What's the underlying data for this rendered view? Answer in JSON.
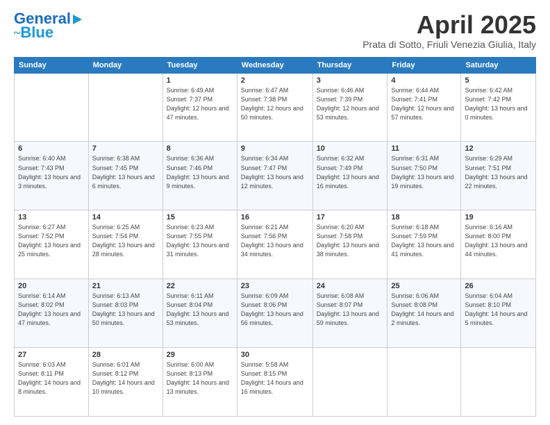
{
  "logo": {
    "line1": "General",
    "line2": "Blue"
  },
  "title": {
    "month": "April 2025",
    "location": "Prata di Sotto, Friuli Venezia Giulia, Italy"
  },
  "headers": [
    "Sunday",
    "Monday",
    "Tuesday",
    "Wednesday",
    "Thursday",
    "Friday",
    "Saturday"
  ],
  "weeks": [
    [
      {
        "day": "",
        "info": ""
      },
      {
        "day": "",
        "info": ""
      },
      {
        "day": "1",
        "info": "Sunrise: 6:49 AM\nSunset: 7:37 PM\nDaylight: 12 hours\nand 47 minutes."
      },
      {
        "day": "2",
        "info": "Sunrise: 6:47 AM\nSunset: 7:38 PM\nDaylight: 12 hours\nand 50 minutes."
      },
      {
        "day": "3",
        "info": "Sunrise: 6:46 AM\nSunset: 7:39 PM\nDaylight: 12 hours\nand 53 minutes."
      },
      {
        "day": "4",
        "info": "Sunrise: 6:44 AM\nSunset: 7:41 PM\nDaylight: 12 hours\nand 57 minutes."
      },
      {
        "day": "5",
        "info": "Sunrise: 6:42 AM\nSunset: 7:42 PM\nDaylight: 13 hours\nand 0 minutes."
      }
    ],
    [
      {
        "day": "6",
        "info": "Sunrise: 6:40 AM\nSunset: 7:43 PM\nDaylight: 13 hours\nand 3 minutes."
      },
      {
        "day": "7",
        "info": "Sunrise: 6:38 AM\nSunset: 7:45 PM\nDaylight: 13 hours\nand 6 minutes."
      },
      {
        "day": "8",
        "info": "Sunrise: 6:36 AM\nSunset: 7:46 PM\nDaylight: 13 hours\nand 9 minutes."
      },
      {
        "day": "9",
        "info": "Sunrise: 6:34 AM\nSunset: 7:47 PM\nDaylight: 13 hours\nand 12 minutes."
      },
      {
        "day": "10",
        "info": "Sunrise: 6:32 AM\nSunset: 7:49 PM\nDaylight: 13 hours\nand 16 minutes."
      },
      {
        "day": "11",
        "info": "Sunrise: 6:31 AM\nSunset: 7:50 PM\nDaylight: 13 hours\nand 19 minutes."
      },
      {
        "day": "12",
        "info": "Sunrise: 6:29 AM\nSunset: 7:51 PM\nDaylight: 13 hours\nand 22 minutes."
      }
    ],
    [
      {
        "day": "13",
        "info": "Sunrise: 6:27 AM\nSunset: 7:52 PM\nDaylight: 13 hours\nand 25 minutes."
      },
      {
        "day": "14",
        "info": "Sunrise: 6:25 AM\nSunset: 7:54 PM\nDaylight: 13 hours\nand 28 minutes."
      },
      {
        "day": "15",
        "info": "Sunrise: 6:23 AM\nSunset: 7:55 PM\nDaylight: 13 hours\nand 31 minutes."
      },
      {
        "day": "16",
        "info": "Sunrise: 6:21 AM\nSunset: 7:56 PM\nDaylight: 13 hours\nand 34 minutes."
      },
      {
        "day": "17",
        "info": "Sunrise: 6:20 AM\nSunset: 7:58 PM\nDaylight: 13 hours\nand 38 minutes."
      },
      {
        "day": "18",
        "info": "Sunrise: 6:18 AM\nSunset: 7:59 PM\nDaylight: 13 hours\nand 41 minutes."
      },
      {
        "day": "19",
        "info": "Sunrise: 6:16 AM\nSunset: 8:00 PM\nDaylight: 13 hours\nand 44 minutes."
      }
    ],
    [
      {
        "day": "20",
        "info": "Sunrise: 6:14 AM\nSunset: 8:02 PM\nDaylight: 13 hours\nand 47 minutes."
      },
      {
        "day": "21",
        "info": "Sunrise: 6:13 AM\nSunset: 8:03 PM\nDaylight: 13 hours\nand 50 minutes."
      },
      {
        "day": "22",
        "info": "Sunrise: 6:11 AM\nSunset: 8:04 PM\nDaylight: 13 hours\nand 53 minutes."
      },
      {
        "day": "23",
        "info": "Sunrise: 6:09 AM\nSunset: 8:06 PM\nDaylight: 13 hours\nand 56 minutes."
      },
      {
        "day": "24",
        "info": "Sunrise: 6:08 AM\nSunset: 8:07 PM\nDaylight: 13 hours\nand 59 minutes."
      },
      {
        "day": "25",
        "info": "Sunrise: 6:06 AM\nSunset: 8:08 PM\nDaylight: 14 hours\nand 2 minutes."
      },
      {
        "day": "26",
        "info": "Sunrise: 6:04 AM\nSunset: 8:10 PM\nDaylight: 14 hours\nand 5 minutes."
      }
    ],
    [
      {
        "day": "27",
        "info": "Sunrise: 6:03 AM\nSunset: 8:11 PM\nDaylight: 14 hours\nand 8 minutes."
      },
      {
        "day": "28",
        "info": "Sunrise: 6:01 AM\nSunset: 8:12 PM\nDaylight: 14 hours\nand 10 minutes."
      },
      {
        "day": "29",
        "info": "Sunrise: 6:00 AM\nSunset: 8:13 PM\nDaylight: 14 hours\nand 13 minutes."
      },
      {
        "day": "30",
        "info": "Sunrise: 5:58 AM\nSunset: 8:15 PM\nDaylight: 14 hours\nand 16 minutes."
      },
      {
        "day": "",
        "info": ""
      },
      {
        "day": "",
        "info": ""
      },
      {
        "day": "",
        "info": ""
      }
    ]
  ]
}
